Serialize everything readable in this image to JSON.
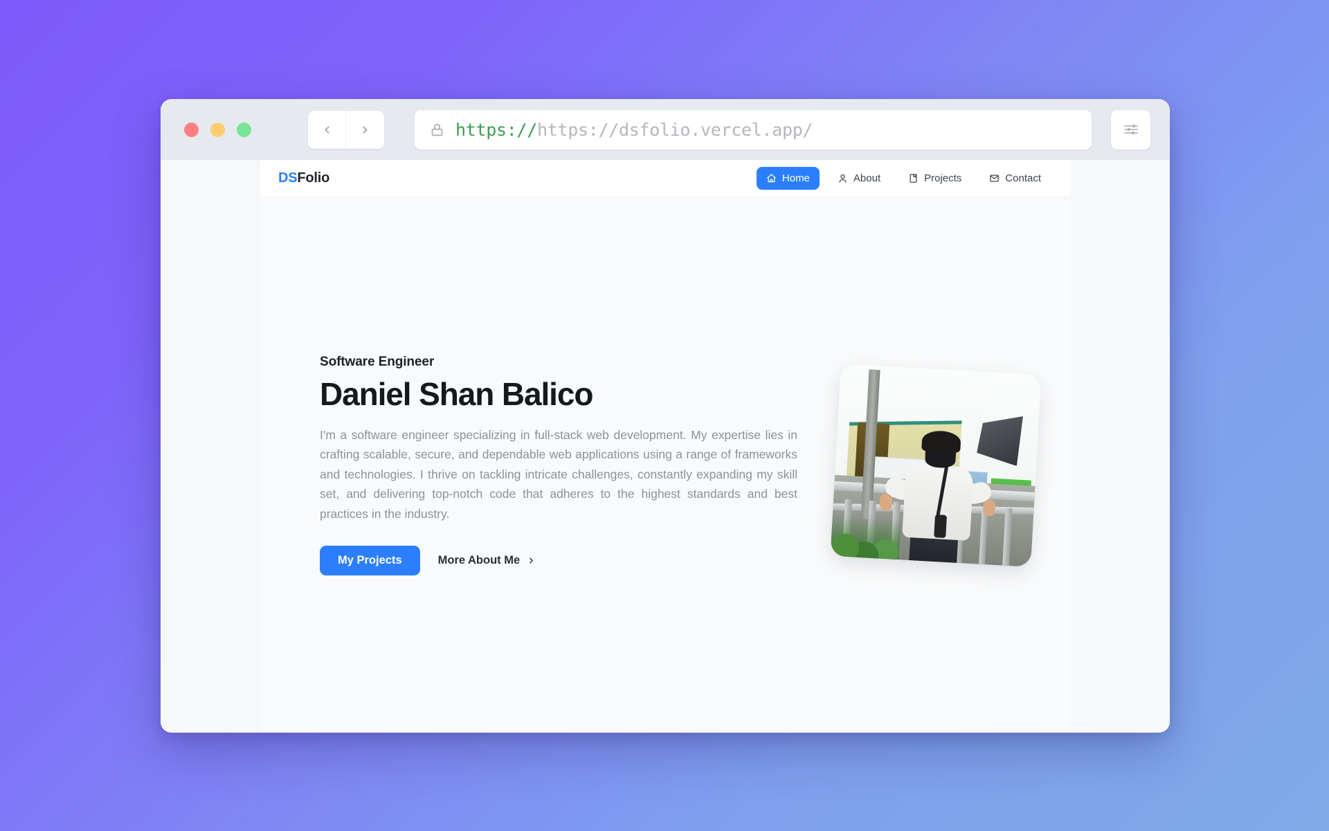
{
  "background": {
    "gradient_from": "#7c5cfc",
    "gradient_to": "#7faae8"
  },
  "browser": {
    "traffic_lights": [
      {
        "name": "close",
        "color": "#ff8080"
      },
      {
        "name": "minimize",
        "color": "#ffcc70"
      },
      {
        "name": "maximize",
        "color": "#78e495"
      }
    ],
    "back_icon": "chevron-left-icon",
    "forward_icon": "chevron-right-icon",
    "lock_icon": "lock-icon",
    "url_scheme": "https://",
    "url_rest": "https://dsfolio.vercel.app/",
    "url_full": "https://https://dsfolio.vercel.app/",
    "settings_icon": "sliders-icon"
  },
  "site": {
    "logo": {
      "prefix": "DS",
      "suffix": "Folio",
      "accent": "#2b7fff"
    },
    "menu": [
      {
        "label": "Home",
        "icon": "home-icon",
        "active": true
      },
      {
        "label": "About",
        "icon": "user-icon",
        "active": false
      },
      {
        "label": "Projects",
        "icon": "document-icon",
        "active": false
      },
      {
        "label": "Contact",
        "icon": "mail-icon",
        "active": false
      }
    ]
  },
  "hero": {
    "eyebrow": "Software Engineer",
    "title": "Daniel Shan Balico",
    "body": "I'm a software engineer specializing in full-stack web development. My expertise lies in crafting scalable, secure, and dependable web applications using a range of frameworks and technologies. I thrive on tackling intricate challenges, constantly expanding my skill set, and delivering top-notch code that adheres to the highest standards and best practices in the industry.",
    "primary_cta": "My Projects",
    "secondary_cta": "More About Me",
    "secondary_cta_icon": "chevron-right-icon",
    "photo_alt": "Portrait photo of Daniel Shan Balico outdoors wearing a face mask"
  }
}
